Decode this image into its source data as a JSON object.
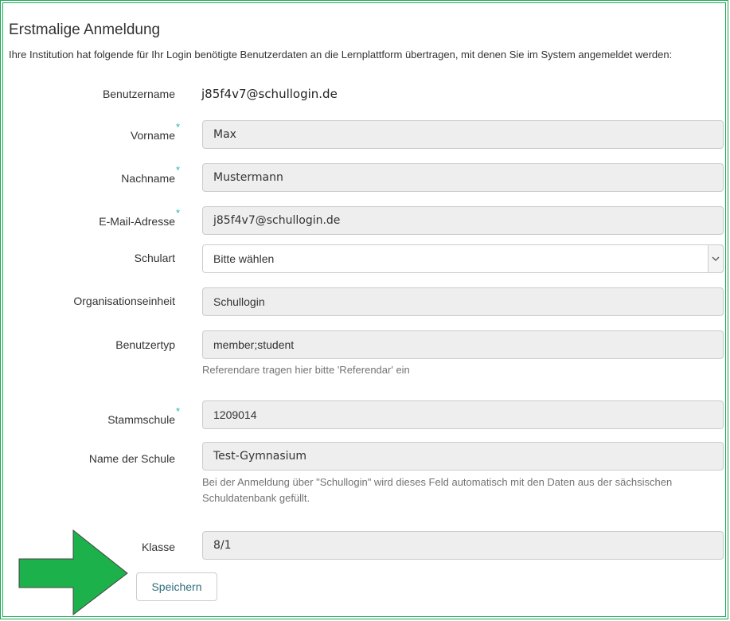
{
  "title": "Erstmalige Anmeldung",
  "intro": "Ihre Institution hat folgende für Ihr Login benötigte Benutzerdaten an die Lernplattform übertragen, mit denen Sie im System angemeldet werden:",
  "required_marker": "*",
  "fields": {
    "benutzername": {
      "label": "Benutzername",
      "value": "j85f4v7@schullogin.de"
    },
    "vorname": {
      "label": "Vorname",
      "value": "Max"
    },
    "nachname": {
      "label": "Nachname",
      "value": "Mustermann"
    },
    "email": {
      "label": "E-Mail-Adresse",
      "value": "j85f4v7@schullogin.de"
    },
    "schulart": {
      "label": "Schulart",
      "value": "Bitte wählen"
    },
    "organisationseinheit": {
      "label": "Organisationseinheit",
      "value": "Schullogin"
    },
    "benutzertyp": {
      "label": "Benutzertyp",
      "value": "member;student",
      "help": "Referendare tragen hier bitte 'Referendar' ein"
    },
    "stammschule": {
      "label": "Stammschule",
      "value": "1209014"
    },
    "schulname": {
      "label": "Name der Schule",
      "value": "Test-Gymnasium",
      "help": "Bei der Anmeldung über \"Schullogin\" wird dieses Feld automatisch mit den Daten aus der sächsischen Schuldatenbank gefüllt."
    },
    "klasse": {
      "label": "Klasse",
      "value": "8/1"
    }
  },
  "save_label": "Speichern",
  "icons": {
    "select": "chevron-down-icon",
    "pointer": "arrow-right-icon"
  },
  "colors": {
    "frame": "#1aaa55",
    "arrow": "#1db14b",
    "required": "#2bb3a9",
    "button_text": "#2f6f7d"
  }
}
